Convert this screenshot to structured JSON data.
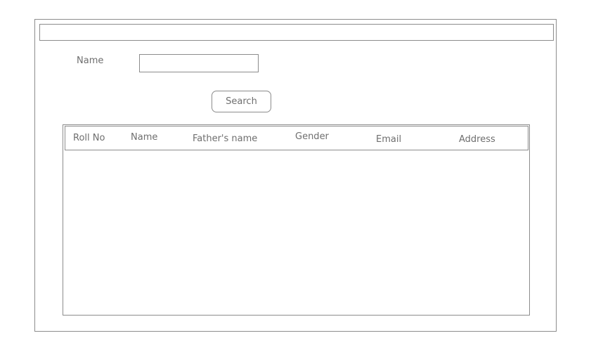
{
  "form": {
    "name_label": "Name",
    "name_value": "",
    "search_label": "Search"
  },
  "table": {
    "columns": [
      "Roll No",
      "Name",
      "Father's name",
      "Gender",
      "Email",
      "Address"
    ],
    "rows": []
  }
}
